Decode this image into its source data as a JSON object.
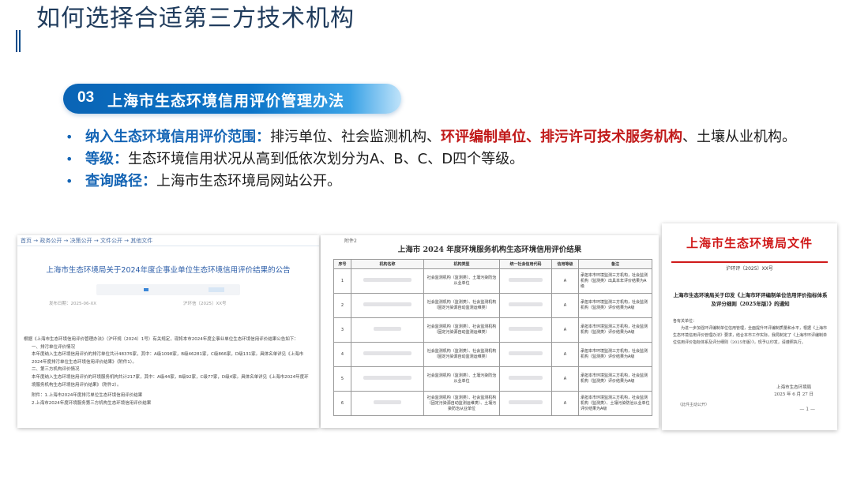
{
  "slide": {
    "title": "如何选择合适第三方技术机构",
    "section_number": "03",
    "section_title": "上海市生态环境信用评价管理办法"
  },
  "bullets": [
    {
      "key": "纳入生态环境信用评价范围：",
      "text_a": "排污单位、社会监测机构、",
      "highlight": "环评编制单位、排污许可技术服务机构",
      "text_b": "、土壤从业机构。"
    },
    {
      "key": "等级：",
      "text": "生态环境信用状况从高到低依次划分为A、B、C、D四个等级。"
    },
    {
      "key": "查询路径：",
      "text": "上海市生态环境局网站公开。"
    }
  ],
  "shot1": {
    "breadcrumb": "首页 → 政务公开 → 决策公开 → 文件公开 → 其他文件",
    "title": "上海市生态环境局关于2024年度企事业单位生态环境信用评价结果的公告",
    "meta_left": "发布日期：2025-06-XX",
    "meta_right": "沪环信〔2025〕XX号",
    "body": [
      "根据《上海市生态环境信用评价管理办法》（沪环规〔2024〕1号）有关规定，现将本市2024年度企事业单位生态环境信用评价结果公告如下：",
      "一、排污单位评价情况",
      "本年度纳入生态环境信用评价的排污单位共计48376家，其中：A级1098家，B级46281家，C级866家，D级131家。具体名单详见《上海市2024年度排污单位生态环境信用评价结果》（附件1）。",
      "二、第三方机构评价情况",
      "本年度纳入生态环境信用评价的环境服务机构共计217家，其中：A级44家，B级92家，C级77家，D级4家。具体名单详见《上海市2024年度环境服务机构生态环境信用评价结果》（附件2）。",
      "附件：1.上海市2024年度排污单位生态环境信用评价结果",
      "2.上海市2024年度环境服务第三方机构生态环境信用评价结果"
    ]
  },
  "shot2": {
    "top_note": "附件2",
    "title": "上海市 2024 年度环境服务机构生态环境信用评价结果",
    "columns": [
      "序号",
      "机构名称",
      "机构类型",
      "统一社会信用代码",
      "信用等级",
      "备注"
    ],
    "rows": [
      {
        "no": "1",
        "type": "社会监测机构（监测类）、土壤污染防治从业单位",
        "grade": "A",
        "note": "承担本市环境监测三方机构，社会监测机构（监测类）出具本年评价结果为A级"
      },
      {
        "no": "2",
        "type": "社会监测机构（监测类）、社会监测机构（固定污染源自动监测运维类）",
        "grade": "A",
        "note": "承担本市环境监测三方机构，社会监测机构（监测类）评价结果为A级"
      },
      {
        "no": "3",
        "type": "社会监测机构（监测类）、社会监测机构（固定污染源自动监测运维类）",
        "grade": "A",
        "note": "承担本市环境监测三方机构，社会监测机构（监测类）评价结果为A级"
      },
      {
        "no": "4",
        "type": "社会监测机构（监测类）、社会监测机构（固定污染源自动监测运维类）",
        "grade": "A",
        "note": "承担本市环境监测三方机构，社会监测机构（监测类）评价结果为A级"
      },
      {
        "no": "5",
        "type": "社会监测机构（监测类）、土壤污染防治从业单位",
        "grade": "A",
        "note": "承担本市环境监测三方机构，社会监测机构（监测类）评价结果为A级"
      },
      {
        "no": "6",
        "type": "社会监测机构（监测类）、社会监测机构（固定污染源自动监测运维类）、土壤污染防治从业单位",
        "grade": "A",
        "note": "承担本市环境监测三方机构，社会监测机构（监测类）、土壤污染防治从业单位评价结果为A级"
      }
    ]
  },
  "shot3": {
    "header": "上海市生态环境局文件",
    "doc_no": "沪环评〔2025〕XX号",
    "subject": "上海市生态环境局关于印发《上海市环评编制单位信用评价指标体系及评分细则（2025年版）》的通知",
    "body": [
      "各有关单位：",
      "为进一步加强环评编制单位信用管理，全面提升环评编制质量和水平，根据《上海市生态环境信用评价管理办法》要求，结合本市工作实际，我局制定了《上海市环评编制单位信用评价指标体系及评分细则（2025年版）》，现予以印发，请遵照执行。"
    ],
    "sign_org": "上海市生态环境局",
    "sign_date": "2025 年 6 月 27 日",
    "footnote": "（此件主动公开）",
    "page": "— 1 —"
  },
  "colors": {
    "accent_blue": "#1565b5",
    "highlight_red": "#c11a1a",
    "title_color": "#1f3b5c",
    "doc_red": "#d01a1a"
  }
}
